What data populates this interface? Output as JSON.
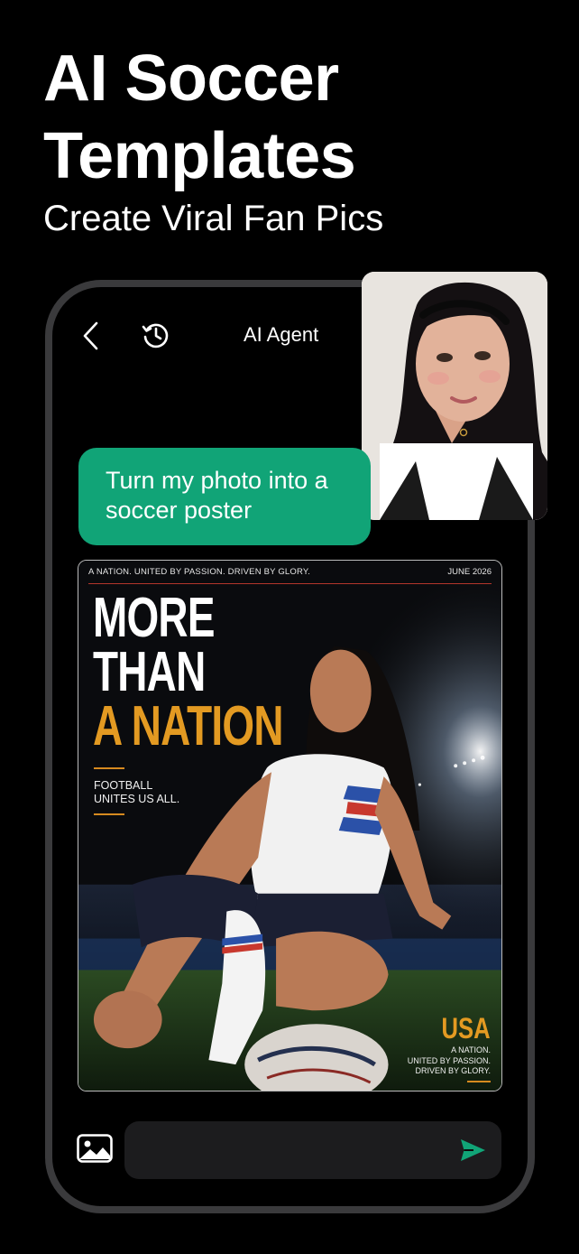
{
  "promo": {
    "headline_line1": "AI Soccer",
    "headline_line2": "Templates",
    "subheadline": "Create Viral Fan Pics"
  },
  "header": {
    "back_icon": "chevron-left-icon",
    "history_icon": "history-icon",
    "title": "AI Agent"
  },
  "chat": {
    "user_message": "Turn my photo into a soccer poster"
  },
  "poster": {
    "top_tagline": "A NATION. UNITED BY PASSION. DRIVEN BY GLORY.",
    "date": "JUNE 2026",
    "headline_line1": "MORE",
    "headline_line2": "THAN",
    "headline_line3": "A NATION",
    "tagline": "FOOTBALL\nUNITES US ALL.",
    "country": "USA",
    "country_sub": "A NATION.\nUNITED BY PASSION.\nDRIVEN BY GLORY."
  },
  "composer": {
    "placeholder": "",
    "gallery_icon": "image-gallery-icon",
    "send_icon": "send-icon"
  },
  "colors": {
    "background": "#000000",
    "bubble": "#11a477",
    "accent_orange": "#e39a22",
    "send": "#11a477",
    "input_bg": "#1c1c1e",
    "phone_frame": "#3a3a3c"
  }
}
